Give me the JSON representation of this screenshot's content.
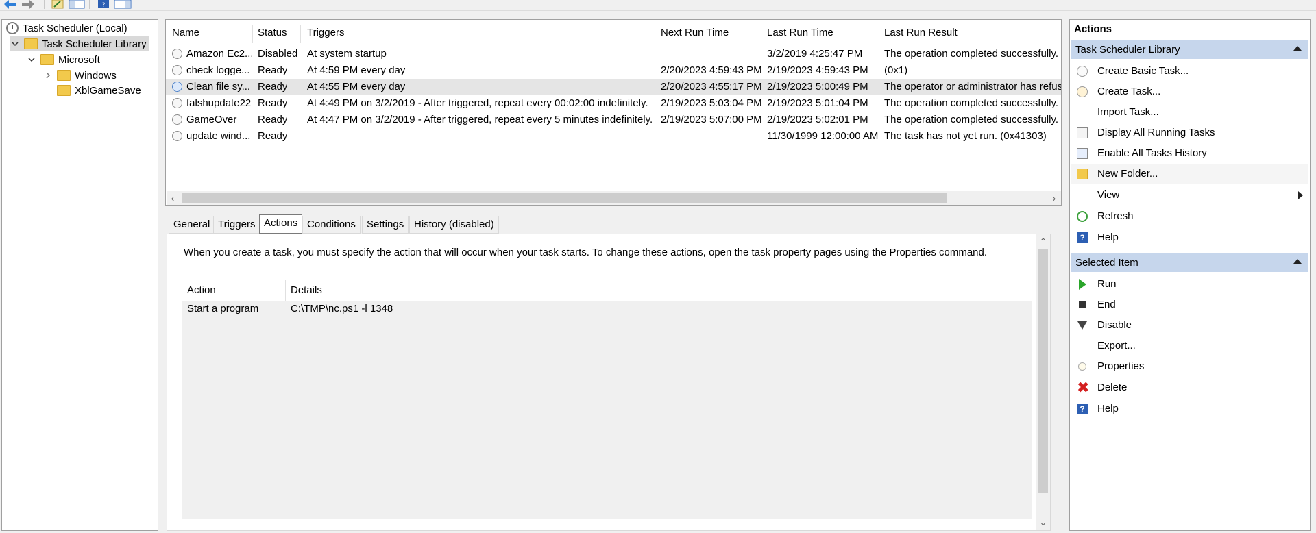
{
  "tree": {
    "items": [
      {
        "label": "Task Scheduler (Local)"
      },
      {
        "label": "Task Scheduler Library"
      },
      {
        "label": "Microsoft"
      },
      {
        "label": "Windows"
      },
      {
        "label": "XblGameSave"
      }
    ]
  },
  "task_list": {
    "columns": [
      "Name",
      "Status",
      "Triggers",
      "Next Run Time",
      "Last Run Time",
      "Last Run Result"
    ],
    "rows": [
      {
        "name": "Amazon Ec2...",
        "status": "Disabled",
        "triggers": "At system startup",
        "next": "",
        "last": "3/2/2019 4:25:47 PM",
        "result": "The operation completed successfully."
      },
      {
        "name": "check logge...",
        "status": "Ready",
        "triggers": "At 4:59 PM every day",
        "next": "2/20/2023 4:59:43 PM",
        "last": "2/19/2023 4:59:43 PM",
        "result": "(0x1)"
      },
      {
        "name": "Clean file sy...",
        "status": "Ready",
        "triggers": "At 4:55 PM every day",
        "next": "2/20/2023 4:55:17 PM",
        "last": "2/19/2023 5:00:49 PM",
        "result": "The operator or administrator has refus"
      },
      {
        "name": "falshupdate22",
        "status": "Ready",
        "triggers": "At 4:49 PM on 3/2/2019 - After triggered, repeat every 00:02:00 indefinitely.",
        "next": "2/19/2023 5:03:04 PM",
        "last": "2/19/2023 5:01:04 PM",
        "result": "The operation completed successfully."
      },
      {
        "name": "GameOver",
        "status": "Ready",
        "triggers": "At 4:47 PM on 3/2/2019 - After triggered, repeat every 5 minutes indefinitely.",
        "next": "2/19/2023 5:07:00 PM",
        "last": "2/19/2023 5:02:01 PM",
        "result": "The operation completed successfully."
      },
      {
        "name": "update wind...",
        "status": "Ready",
        "triggers": "",
        "next": "",
        "last": "11/30/1999 12:00:00 AM",
        "result": "The task has not yet run. (0x41303)"
      }
    ]
  },
  "detail": {
    "tabs": [
      "General",
      "Triggers",
      "Actions",
      "Conditions",
      "Settings",
      "History (disabled)"
    ],
    "active_tab": "Actions",
    "description": "When you create a task, you must specify the action that will occur when your task starts.  To change these actions, open the task property pages using the Properties command.",
    "table": {
      "columns": [
        "Action",
        "Details"
      ],
      "rows": [
        {
          "action": "Start a program",
          "details": "C:\\TMP\\nc.ps1 -l 1348"
        }
      ]
    }
  },
  "actions_pane": {
    "title": "Actions",
    "section1": {
      "label": "Task Scheduler Library",
      "items": [
        "Create Basic Task...",
        "Create Task...",
        "Import Task...",
        "Display All Running Tasks",
        "Enable All Tasks History",
        "New Folder...",
        "View",
        "Refresh",
        "Help"
      ]
    },
    "section2": {
      "label": "Selected Item",
      "items": [
        "Run",
        "End",
        "Disable",
        "Export...",
        "Properties",
        "Delete",
        "Help"
      ]
    }
  },
  "colors": {
    "section_header": "#c6d6ec",
    "selected_tree": "#d9d9d9",
    "row_highlight": "#e5e5e5",
    "run_green": "#2aa52a",
    "delete_red": "#d42020",
    "help_blue": "#2d5fb3"
  }
}
